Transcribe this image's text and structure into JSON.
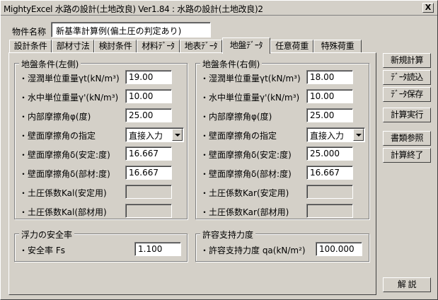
{
  "window": {
    "title": "MightyExcel 水路の設計(土地改良) Ver1.84 : 水路の設計(土地改良)2",
    "close_glyph": "X"
  },
  "project": {
    "label": "物件名称",
    "value": "新基準計算例(偏土圧の判定あり)"
  },
  "tabs": [
    {
      "label": "設計条件"
    },
    {
      "label": "部材寸法"
    },
    {
      "label": "検討条件"
    },
    {
      "label": "材料ﾃﾞｰﾀ"
    },
    {
      "label": "地表ﾃﾞｰﾀ"
    },
    {
      "label": "地盤ﾃﾞｰﾀ",
      "active": true
    },
    {
      "label": "任意荷重"
    },
    {
      "label": "特殊荷重"
    }
  ],
  "left_ground": {
    "title": "地盤条件(左側)",
    "rows": [
      {
        "label": "・湿潤単位重量γt(kN/m³)",
        "value": "19.00"
      },
      {
        "label": "・水中単位重量γ'(kN/m³)",
        "value": "10.00"
      },
      {
        "label": "・内部摩擦角φ(度)",
        "value": "25.00"
      },
      {
        "label": "・壁面摩擦角の指定",
        "value": "直接入力"
      },
      {
        "label": "・壁面摩擦角δ(安定:度)",
        "value": "16.667"
      },
      {
        "label": "・壁面摩擦角δ(部材:度)",
        "value": "16.667"
      },
      {
        "label": "・土圧係数Kal(安定用)",
        "value": ""
      },
      {
        "label": "・土圧係数Kal(部材用)",
        "value": ""
      }
    ]
  },
  "right_ground": {
    "title": "地盤条件(右側)",
    "rows": [
      {
        "label": "・湿潤単位重量γt(kN/m³)",
        "value": "18.00"
      },
      {
        "label": "・水中単位重量γ'(kN/m³)",
        "value": "10.00"
      },
      {
        "label": "・内部摩擦角φ(度)",
        "value": "25.00"
      },
      {
        "label": "・壁面摩擦角の指定",
        "value": "直接入力"
      },
      {
        "label": "・壁面摩擦角δ(安定:度)",
        "value": "25.000"
      },
      {
        "label": "・壁面摩擦角δ(部材:度)",
        "value": "16.667"
      },
      {
        "label": "・土圧係数Kar(安定用)",
        "value": ""
      },
      {
        "label": "・土圧係数Kar(部材用)",
        "value": ""
      }
    ]
  },
  "buoyancy": {
    "title": "浮力の安全率",
    "label": "・安全率 Fs",
    "value": "1.100"
  },
  "bearing": {
    "title": "許容支持力度",
    "label": "・許容支持力度 qa(kN/m²)",
    "value": "100.000"
  },
  "side_buttons": {
    "new": "新規計算",
    "load": "ﾃﾞｰﾀ読込",
    "save": "ﾃﾞｰﾀ保存",
    "run": "計算実行",
    "docs": "書類参照",
    "exit": "計算終了",
    "help": "解 説"
  }
}
